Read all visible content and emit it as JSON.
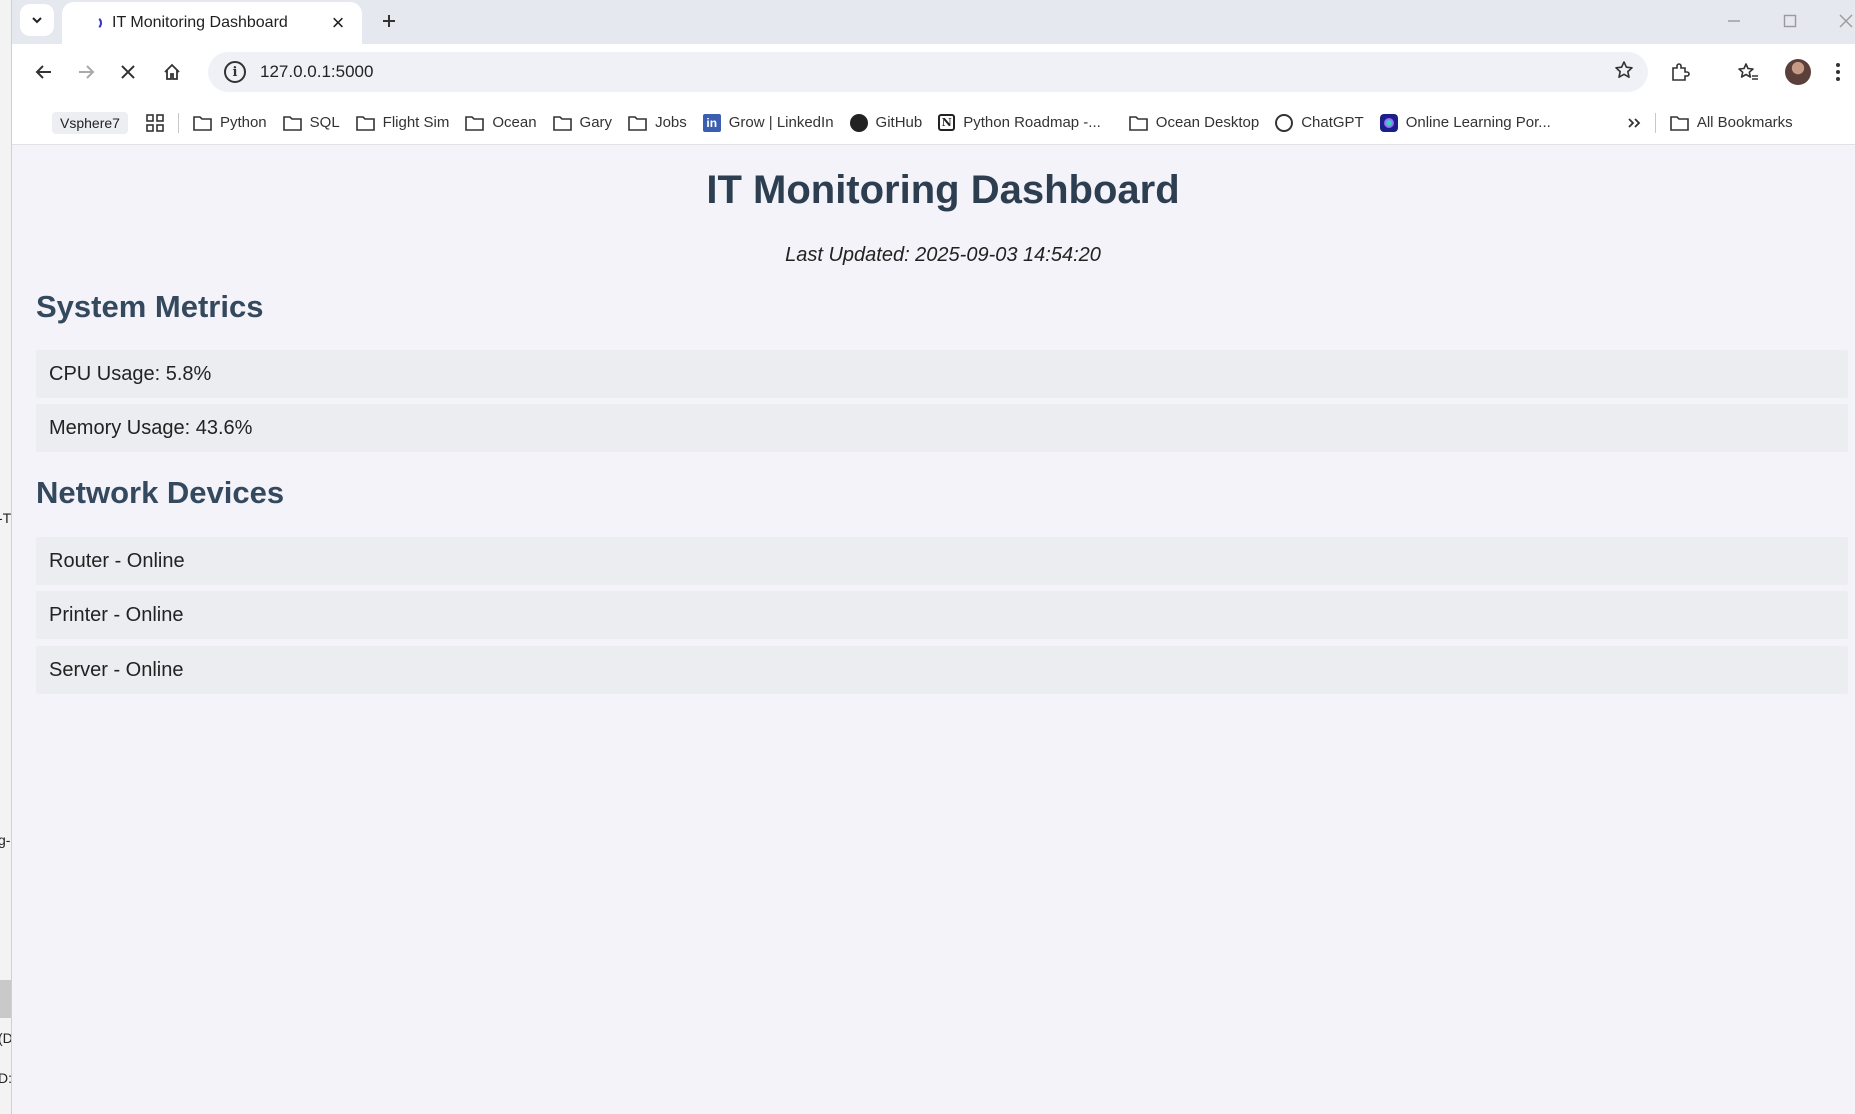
{
  "background_window": {
    "fragments": [
      "-T",
      "g-",
      "(D",
      "D:"
    ]
  },
  "browser": {
    "tab": {
      "title": "IT Monitoring Dashboard"
    },
    "address": {
      "url": "127.0.0.1:5000"
    },
    "bookmarks": {
      "profile_chip": "Vsphere7",
      "items": [
        {
          "label": "Python",
          "icon": "folder-icon"
        },
        {
          "label": "SQL",
          "icon": "folder-icon"
        },
        {
          "label": "Flight Sim",
          "icon": "folder-icon"
        },
        {
          "label": "Ocean",
          "icon": "folder-icon"
        },
        {
          "label": "Gary",
          "icon": "folder-icon"
        },
        {
          "label": "Jobs",
          "icon": "folder-icon"
        },
        {
          "label": "Grow | LinkedIn",
          "icon": "linkedin-icon"
        },
        {
          "label": "GitHub",
          "icon": "github-icon"
        },
        {
          "label": "Python Roadmap -...",
          "icon": "notion-icon"
        },
        {
          "label": "Ocean Desktop",
          "icon": "folder-icon"
        },
        {
          "label": "ChatGPT",
          "icon": "chatgpt-icon"
        },
        {
          "label": "Online Learning Por...",
          "icon": "learning-portal-icon"
        }
      ],
      "all_bookmarks": "All Bookmarks"
    }
  },
  "dashboard": {
    "title": "IT Monitoring Dashboard",
    "last_updated": "Last Updated: 2025-09-03 14:54:20",
    "system_metrics": {
      "heading": "System Metrics",
      "items": [
        "CPU Usage: 5.8%",
        "Memory Usage: 43.6%"
      ]
    },
    "network_devices": {
      "heading": "Network Devices",
      "items": [
        "Router - Online",
        "Printer - Online",
        "Server - Online"
      ]
    }
  },
  "colors": {
    "page_background": "#f3f3f9",
    "item_background": "#ecedf1",
    "title_color": "#2c3e50",
    "heading_color": "#34495e",
    "tab_spinner": "#3b34c8"
  }
}
